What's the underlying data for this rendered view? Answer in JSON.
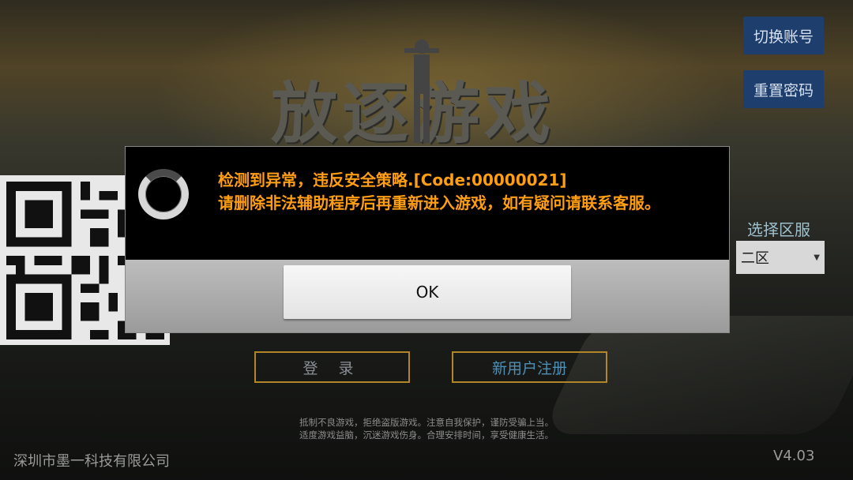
{
  "game": {
    "title": "放逐游戏"
  },
  "side_buttons": {
    "switch_account": "切换账号",
    "reset_password": "重置密码"
  },
  "region": {
    "label": "选择区服",
    "selected": "二区"
  },
  "buttons": {
    "login": "登 录",
    "register": "新用户注册"
  },
  "notice": {
    "line1": "抵制不良游戏，拒绝盗版游戏。注意自我保护，谨防受骗上当。",
    "line2": "适度游戏益脑，沉迷游戏伤身。合理安排时间，享受健康生活。"
  },
  "footer": {
    "company": "深圳市墨一科技有限公司",
    "version": "V4.03"
  },
  "dialog": {
    "message_line1": "检测到异常，违反安全策略.[Code:00000021]",
    "message_line2": "请删除非法辅助程序后再重新进入游戏，如有疑问请联系客服。",
    "ok_label": "OK"
  },
  "colors": {
    "accent_orange": "#ff9d13",
    "side_button_blue": "#1e3f6d",
    "gold_outline": "#b08628"
  }
}
